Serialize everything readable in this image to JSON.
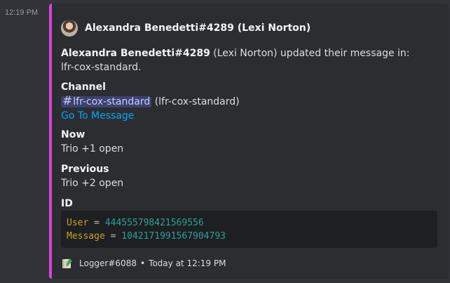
{
  "timestamp": "12:19 PM",
  "embed": {
    "accent_color": "#e040e0",
    "author": {
      "name": "Alexandra Benedetti#4289 (Lexi Norton)",
      "avatar_icon": "user-avatar"
    },
    "description": {
      "bold_name": "Alexandra Benedetti#4289",
      "rest": " (Lexi Norton) updated their message in: lfr-cox-standard."
    },
    "fields": {
      "channel": {
        "name": "Channel",
        "mention_hash": "#",
        "mention_label": "lfr-cox-standard",
        "mention_suffix": " (lfr-cox-standard)",
        "link": "Go To Message"
      },
      "now": {
        "name": "Now",
        "value": "Trio +1 open"
      },
      "previous": {
        "name": "Previous",
        "value": "Trio +2 open"
      },
      "id": {
        "name": "ID"
      }
    },
    "code": {
      "line1": {
        "key": "User",
        "eq": " = ",
        "value": "444555798421569556"
      },
      "line2": {
        "key": "Message",
        "eq": " = ",
        "value": "1042171991567904793"
      }
    },
    "footer": {
      "icon": "logger-notebook-icon",
      "name": "Logger#6088",
      "separator": "•",
      "time": "Today at 12:19 PM"
    }
  }
}
